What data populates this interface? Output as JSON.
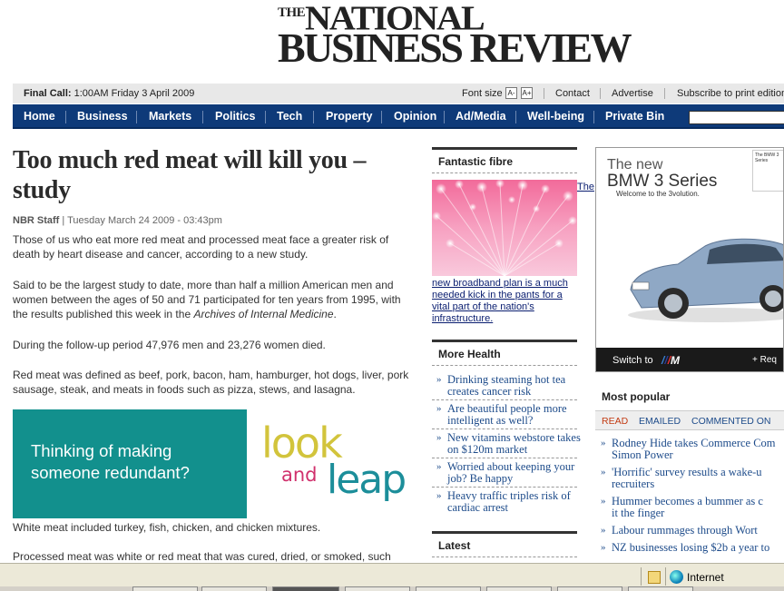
{
  "masthead": {
    "the": "THE",
    "national": "NATIONAL",
    "business_review": "BUSINESS REVIEW"
  },
  "topbar": {
    "final_call_label": "Final Call:",
    "final_call_time": "1:00AM Friday 3 April 2009",
    "font_size_label": "Font size",
    "font_small": "A-",
    "font_large": "A+",
    "contact": "Contact",
    "advertise": "Advertise",
    "subscribe": "Subscribe to print edition"
  },
  "nav": [
    "Home",
    "Business",
    "Markets",
    "Politics",
    "Tech",
    "Property",
    "Opinion",
    "Ad/Media",
    "Well-being",
    "Private Bin"
  ],
  "article": {
    "headline": "Too much red meat will kill you – study",
    "author": "NBR Staff",
    "date": "Tuesday March 24 2009 - 03:43pm",
    "p1": "Those of us who eat more red meat and processed meat face a greater risk of death by heart disease and cancer, according to a new study.",
    "p2a": "Said to be the largest study to date, more than half a million American men and women between the ages of 50 and 71 participated for ten years from 1995, with the results published this week in the ",
    "p2i": "Archives of Internal Medicine",
    "p2b": ".",
    "p3": "During the follow-up period 47,976 men and 23,276 women died.",
    "p4": "Red meat was defined as beef, pork, bacon, ham, hamburger, hot dogs, liver, pork sausage, steak, and meats in foods such as pizza, stews, and lasagna.",
    "p5": "White meat included turkey, fish, chicken, and chicken mixtures.",
    "p6": "Processed meat was white or red meat that was cured, dried, or smoked, such"
  },
  "ad": {
    "text": "Thinking of making someone redundant?",
    "look": "look",
    "and": "and",
    "leap": "leap"
  },
  "fibre": {
    "title": "Fantastic fibre",
    "caption": "new broadband plan is a much needed kick in the pants for a vital part of the nation's infrastructure.",
    "the_link": "The"
  },
  "more_health": {
    "title": "More Health",
    "items": [
      "Drinking steaming hot tea creates cancer risk",
      "Are beautiful people more intelligent as well?",
      "New vitamins webstore takes on $120m market",
      "Worried about keeping your job? Be happy",
      "Heavy traffic triples risk of cardiac arrest"
    ]
  },
  "latest": {
    "title": "Latest"
  },
  "bmw_ad": {
    "the_new": "The new",
    "model": "BMW 3 Series",
    "tagline": "Welcome to the 3volution.",
    "switch_to": "Switch to",
    "m_logo": "M",
    "req": "+ Req",
    "tag_text": "The BMW 3 Series"
  },
  "most_popular": {
    "title": "Most popular",
    "tabs": [
      "READ",
      "EMAILED",
      "COMMENTED ON"
    ],
    "items": [
      "Rodney Hide takes Commerce Com",
      "Simon Power",
      "'Horrific' survey results a wake-u",
      "recruiters",
      "Hummer becomes a bummer as c",
      "it the finger",
      "Labour rummages through Wort",
      "NZ businesses losing $2b a year to"
    ]
  },
  "status": {
    "zone": "Internet"
  },
  "colors": {
    "nav": "#0e3a79",
    "headline_link": "#1d4b8a",
    "ad_teal": "#12908d",
    "tab_active": "#c23a12"
  }
}
